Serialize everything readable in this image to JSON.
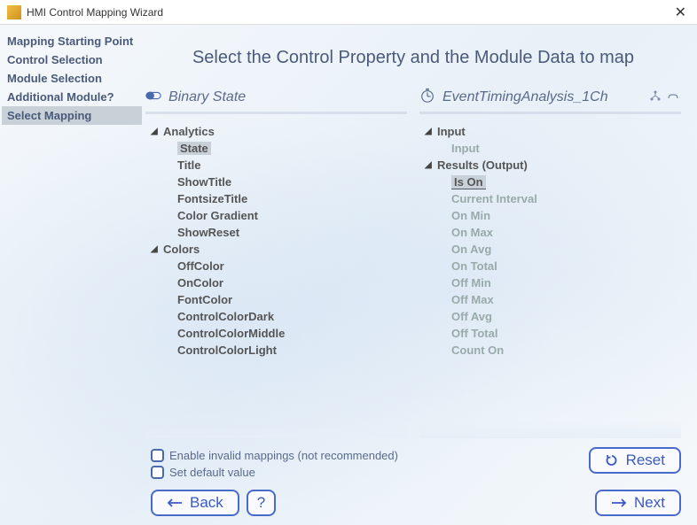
{
  "window": {
    "title": "HMI Control Mapping Wizard"
  },
  "sidebar": {
    "items": [
      {
        "label": "Mapping Starting Point"
      },
      {
        "label": "Control Selection"
      },
      {
        "label": "Module Selection"
      },
      {
        "label": "Additional Module?"
      },
      {
        "label": "Select Mapping"
      }
    ],
    "selected": 4
  },
  "heading": "Select the Control Property and the Module Data to map",
  "left_panel": {
    "title": "Binary State",
    "groups": [
      {
        "label": "Analytics",
        "items": [
          {
            "label": "State",
            "selected": true
          },
          {
            "label": "Title"
          },
          {
            "label": "ShowTitle"
          },
          {
            "label": "FontsizeTitle"
          },
          {
            "label": "Color Gradient"
          },
          {
            "label": "ShowReset"
          }
        ]
      },
      {
        "label": "Colors",
        "items": [
          {
            "label": "OffColor"
          },
          {
            "label": "OnColor"
          },
          {
            "label": "FontColor"
          },
          {
            "label": "ControlColorDark"
          },
          {
            "label": "ControlColorMiddle"
          },
          {
            "label": "ControlColorLight"
          }
        ]
      }
    ]
  },
  "right_panel": {
    "title": "EventTimingAnalysis_1Ch",
    "groups": [
      {
        "label": "Input",
        "items": [
          {
            "label": "Input",
            "disabled": true
          }
        ]
      },
      {
        "label": "Results (Output)",
        "items": [
          {
            "label": "Is On",
            "selected": true
          },
          {
            "label": "Current Interval",
            "disabled": true
          },
          {
            "label": "On Min",
            "disabled": true
          },
          {
            "label": "On Max",
            "disabled": true
          },
          {
            "label": "On Avg",
            "disabled": true
          },
          {
            "label": "On Total",
            "disabled": true
          },
          {
            "label": "Off Min",
            "disabled": true
          },
          {
            "label": "Off Max",
            "disabled": true
          },
          {
            "label": "Off Avg",
            "disabled": true
          },
          {
            "label": "Off Total",
            "disabled": true
          },
          {
            "label": "Count On",
            "disabled": true
          }
        ]
      }
    ]
  },
  "options": {
    "enable_invalid": "Enable invalid mappings (not recommended)",
    "set_default": "Set default value"
  },
  "buttons": {
    "reset": "Reset",
    "back": "Back",
    "help": "?",
    "next": "Next"
  }
}
